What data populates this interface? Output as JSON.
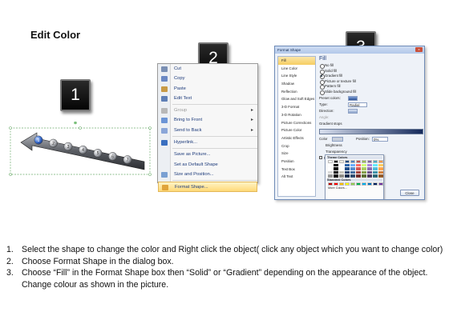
{
  "title": "Edit Color",
  "badges": [
    "1",
    "2",
    "3"
  ],
  "arrow_graphic": {
    "node_labels": [
      "1",
      "2",
      "3",
      "4",
      "5",
      "6",
      "7"
    ]
  },
  "context_menu": {
    "items": [
      {
        "label": "Cut",
        "icon": "scissors-icon",
        "disabled": false,
        "submenu": false
      },
      {
        "label": "Copy",
        "icon": "copy-icon",
        "disabled": false,
        "submenu": false
      },
      {
        "label": "Paste",
        "icon": "paste-icon",
        "disabled": false,
        "submenu": false
      },
      {
        "label": "Edit Text",
        "icon": "edit-text-icon",
        "disabled": false,
        "submenu": false
      },
      {
        "label": "Group",
        "icon": "group-icon",
        "disabled": true,
        "submenu": true
      },
      {
        "label": "Bring to Front",
        "icon": "bring-front-icon",
        "disabled": false,
        "submenu": true
      },
      {
        "label": "Send to Back",
        "icon": "send-back-icon",
        "disabled": false,
        "submenu": true
      },
      {
        "label": "Hyperlink...",
        "icon": "hyperlink-icon",
        "disabled": false,
        "submenu": false
      },
      {
        "label": "Save as Picture...",
        "icon": "",
        "disabled": false,
        "submenu": false
      },
      {
        "label": "Set as Default Shape",
        "icon": "",
        "disabled": false,
        "submenu": false
      },
      {
        "label": "Size and Position...",
        "icon": "size-icon",
        "disabled": false,
        "submenu": false
      },
      {
        "label": "Format Shape...",
        "icon": "format-shape-icon",
        "disabled": false,
        "submenu": false,
        "highlighted": true
      }
    ]
  },
  "format_dialog": {
    "title": "Format Shape",
    "close_glyph": "x",
    "categories": [
      "Fill",
      "Line Color",
      "Line Style",
      "Shadow",
      "Reflection",
      "Glow and Soft Edges",
      "3-D Format",
      "3-D Rotation",
      "Picture Corrections",
      "Picture Color",
      "Artistic Effects",
      "Crop",
      "Size",
      "Position",
      "Text Box",
      "Alt Text"
    ],
    "selected_category": "Fill",
    "section_heading": "Fill",
    "fill_options": [
      "No fill",
      "Solid fill",
      "Gradient fill",
      "Picture or texture fill",
      "Pattern fill",
      "Slide background fill"
    ],
    "selected_fill": "Gradient fill",
    "preset_colors_label": "Preset colors:",
    "type_label": "Type:",
    "type_value": "Radial",
    "direction_label": "Direction:",
    "angle_label": "Angle:",
    "gradient_stops_label": "Gradient stops",
    "color_label": "Color",
    "position_label": "Position:",
    "position_value": "0%",
    "brightness_label": "Brightness",
    "transparency_label": "Transparency",
    "rotate_label": "Rotate with shape",
    "close_label": "Close",
    "palette": {
      "theme_heading": "Theme Colors",
      "standard_heading": "Standard Colors",
      "more_label": "More Colors...",
      "theme_top": [
        "#ffffff",
        "#000000",
        "#eeece1",
        "#1f497d",
        "#4f81bd",
        "#c0504d",
        "#9bbb59",
        "#8064a2",
        "#4bacc6",
        "#f79646"
      ],
      "standard": [
        "#c00000",
        "#ff0000",
        "#ffc000",
        "#ffff00",
        "#92d050",
        "#00b050",
        "#00b0f0",
        "#0070c0",
        "#002060",
        "#7030a0"
      ]
    }
  },
  "steps": [
    {
      "num": "1.",
      "text": "Select the shape to change the color and Right click the object( click any object which you want to change color)"
    },
    {
      "num": "2.",
      "text": "Choose Format Shape in the dialog box."
    },
    {
      "num": "3.",
      "text": "Choose “Fill” in the Format Shape box then “Solid” or “Gradient” depending on the appearance of the object. Change colour as shown in the picture."
    }
  ]
}
